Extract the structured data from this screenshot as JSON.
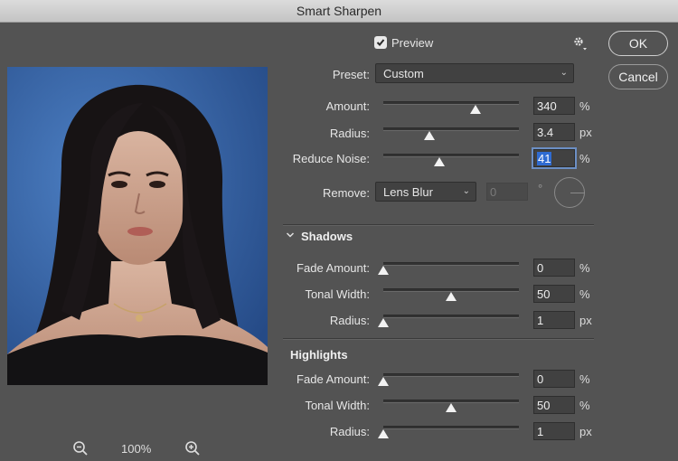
{
  "window": {
    "title": "Smart Sharpen"
  },
  "preview": {
    "label": "Preview",
    "checked": true
  },
  "buttons": {
    "ok": "OK",
    "cancel": "Cancel"
  },
  "zoom": {
    "level": "100%"
  },
  "preset": {
    "label": "Preset:",
    "value": "Custom"
  },
  "main": {
    "amount": {
      "label": "Amount:",
      "value": "340",
      "unit": "%",
      "slider_fraction": 0.68
    },
    "radius": {
      "label": "Radius:",
      "value": "3.4",
      "unit": "px",
      "slider_fraction": 0.34
    },
    "reduce_noise": {
      "label": "Reduce Noise:",
      "value": "41",
      "unit": "%",
      "slider_fraction": 0.41
    },
    "remove": {
      "label": "Remove:",
      "value": "Lens Blur",
      "angle_value": "0",
      "angle_unit": "°"
    }
  },
  "shadows": {
    "title": "Shadows",
    "fade_amount": {
      "label": "Fade Amount:",
      "value": "0",
      "unit": "%",
      "slider_fraction": 0.0
    },
    "tonal_width": {
      "label": "Tonal Width:",
      "value": "50",
      "unit": "%",
      "slider_fraction": 0.5
    },
    "radius": {
      "label": "Radius:",
      "value": "1",
      "unit": "px",
      "slider_fraction": 0.0
    }
  },
  "highlights": {
    "title": "Highlights",
    "fade_amount": {
      "label": "Fade Amount:",
      "value": "0",
      "unit": "%",
      "slider_fraction": 0.0
    },
    "tonal_width": {
      "label": "Tonal Width:",
      "value": "50",
      "unit": "%",
      "slider_fraction": 0.5
    },
    "radius": {
      "label": "Radius:",
      "value": "1",
      "unit": "px",
      "slider_fraction": 0.0
    }
  },
  "icons": {
    "zoom_out": "zoom-out-icon",
    "zoom_in": "zoom-in-icon",
    "gear": "gear-icon",
    "collapse": "chevron-down-icon"
  },
  "colors": {
    "background": "#535353",
    "field": "#414141",
    "selection": "#2f6bd1"
  }
}
